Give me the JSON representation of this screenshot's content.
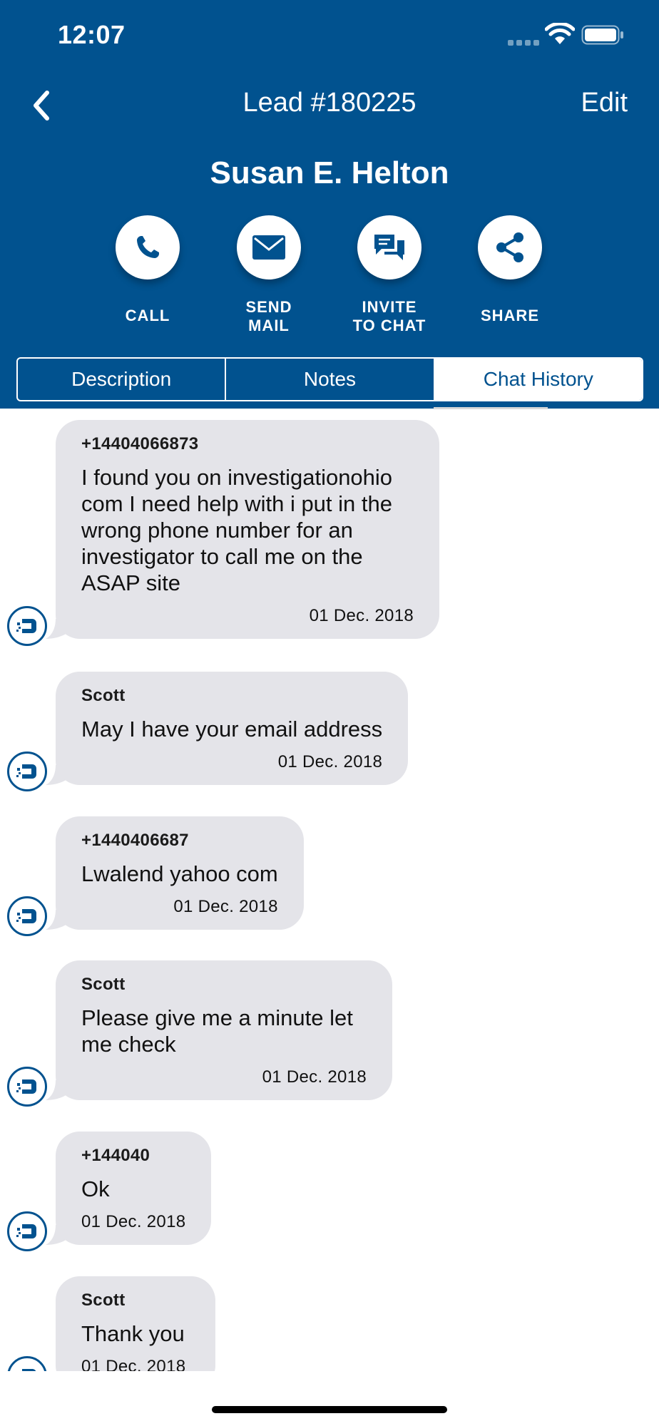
{
  "status_bar": {
    "time": "12:07"
  },
  "nav": {
    "title": "Lead #180225",
    "edit_label": "Edit"
  },
  "lead": {
    "name": "Susan E. Helton"
  },
  "actions": [
    {
      "label": "CALL",
      "icon": "phone-icon"
    },
    {
      "label": "SEND\nMAIL",
      "icon": "mail-icon"
    },
    {
      "label": "INVITE\nTO CHAT",
      "icon": "chat-icon"
    },
    {
      "label": "SHARE",
      "icon": "share-icon"
    }
  ],
  "tabs": [
    {
      "label": "Description"
    },
    {
      "label": "Notes"
    },
    {
      "label": "Chat History",
      "active": true
    }
  ],
  "messages": [
    {
      "sender": "+14404066873",
      "text": "I found you on investigationohio com I need help with i put in the wrong phone number for an investigator to call me on the ASAP site",
      "date": "01 Dec. 2018"
    },
    {
      "sender": "Scott",
      "text": "May I have your email address",
      "date": "01 Dec. 2018"
    },
    {
      "sender": "+1440406687",
      "text": "Lwalend yahoo com",
      "date": "01 Dec. 2018"
    },
    {
      "sender": "Scott",
      "text": "Please give me a minute let me check",
      "date": "01 Dec. 2018"
    },
    {
      "sender": "+144040",
      "text": "Ok",
      "date": "01 Dec. 2018"
    },
    {
      "sender": "Scott",
      "text": "Thank you",
      "date": "01 Dec. 2018"
    }
  ],
  "colors": {
    "brand": "#01528f",
    "bubble": "#e4e4e9"
  }
}
